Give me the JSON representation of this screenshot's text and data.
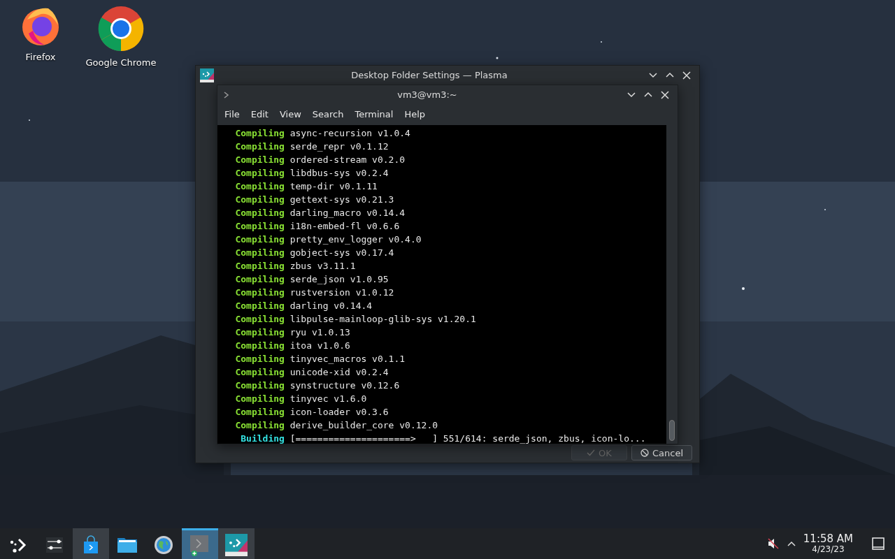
{
  "desktop_icons": [
    {
      "kind": "firefox",
      "label": "Firefox"
    },
    {
      "kind": "chrome",
      "label": "Google Chrome"
    }
  ],
  "dialog": {
    "title": "Desktop Folder Settings — Plasma",
    "buttons": [
      {
        "kind": "ok",
        "label": "OK",
        "disabled": true
      },
      {
        "kind": "cancel",
        "label": "Cancel",
        "disabled": false
      }
    ]
  },
  "terminal": {
    "title": "vm3@vm3:~",
    "menu": [
      "File",
      "Edit",
      "View",
      "Search",
      "Terminal",
      "Help"
    ],
    "lines": [
      {
        "kind": "compiling",
        "status": "Compiling",
        "text": "async-recursion v1.0.4"
      },
      {
        "kind": "compiling",
        "status": "Compiling",
        "text": "serde_repr v0.1.12"
      },
      {
        "kind": "compiling",
        "status": "Compiling",
        "text": "ordered-stream v0.2.0"
      },
      {
        "kind": "compiling",
        "status": "Compiling",
        "text": "libdbus-sys v0.2.4"
      },
      {
        "kind": "compiling",
        "status": "Compiling",
        "text": "temp-dir v0.1.11"
      },
      {
        "kind": "compiling",
        "status": "Compiling",
        "text": "gettext-sys v0.21.3"
      },
      {
        "kind": "compiling",
        "status": "Compiling",
        "text": "darling_macro v0.14.4"
      },
      {
        "kind": "compiling",
        "status": "Compiling",
        "text": "i18n-embed-fl v0.6.6"
      },
      {
        "kind": "compiling",
        "status": "Compiling",
        "text": "pretty_env_logger v0.4.0"
      },
      {
        "kind": "compiling",
        "status": "Compiling",
        "text": "gobject-sys v0.17.4"
      },
      {
        "kind": "compiling",
        "status": "Compiling",
        "text": "zbus v3.11.1"
      },
      {
        "kind": "compiling",
        "status": "Compiling",
        "text": "serde_json v1.0.95"
      },
      {
        "kind": "compiling",
        "status": "Compiling",
        "text": "rustversion v1.0.12"
      },
      {
        "kind": "compiling",
        "status": "Compiling",
        "text": "darling v0.14.4"
      },
      {
        "kind": "compiling",
        "status": "Compiling",
        "text": "libpulse-mainloop-glib-sys v1.20.1"
      },
      {
        "kind": "compiling",
        "status": "Compiling",
        "text": "ryu v1.0.13"
      },
      {
        "kind": "compiling",
        "status": "Compiling",
        "text": "itoa v1.0.6"
      },
      {
        "kind": "compiling",
        "status": "Compiling",
        "text": "tinyvec_macros v0.1.1"
      },
      {
        "kind": "compiling",
        "status": "Compiling",
        "text": "unicode-xid v0.2.4"
      },
      {
        "kind": "compiling",
        "status": "Compiling",
        "text": "synstructure v0.12.6"
      },
      {
        "kind": "compiling",
        "status": "Compiling",
        "text": "tinyvec v1.6.0"
      },
      {
        "kind": "compiling",
        "status": "Compiling",
        "text": "icon-loader v0.3.6"
      },
      {
        "kind": "compiling",
        "status": "Compiling",
        "text": "derive_builder_core v0.12.0"
      },
      {
        "kind": "building",
        "status": "Building",
        "text": "[=====================>   ] 551/614: serde_json, zbus, icon-lo..."
      }
    ]
  },
  "taskbar": {
    "items": [
      {
        "kind": "launcher",
        "open": false,
        "selected": false
      },
      {
        "kind": "sliders",
        "open": false,
        "selected": false
      },
      {
        "kind": "store",
        "open": true,
        "selected": false
      },
      {
        "kind": "folder",
        "open": false,
        "selected": false
      },
      {
        "kind": "globe",
        "open": false,
        "selected": false
      },
      {
        "kind": "terminal",
        "open": true,
        "selected": true
      },
      {
        "kind": "plasma",
        "open": true,
        "selected": false
      }
    ]
  },
  "tray": {
    "muted": true,
    "time": "11:58 AM",
    "date": "4/23/23"
  }
}
